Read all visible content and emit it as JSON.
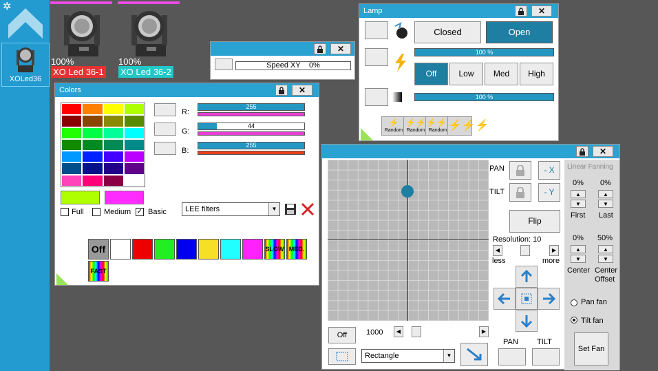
{
  "sidebar": {
    "fixture_label": "XOLed36"
  },
  "fixtures": [
    {
      "pct": "100%",
      "name": "XO Led 36-1",
      "name_bg": "#e53232"
    },
    {
      "pct": "100%",
      "name": "XO Led 36-2",
      "name_bg": "#22c7c7"
    }
  ],
  "speed_window": {
    "label": "Speed XY",
    "value": "0%"
  },
  "lamp": {
    "title": "Lamp",
    "closed": "Closed",
    "open": "Open",
    "intensity": "100 %",
    "off": "Off",
    "low": "Low",
    "med": "Med",
    "high": "High",
    "strobe_intensity": "100 %",
    "random": [
      "Random",
      "Random",
      "Random"
    ]
  },
  "colors": {
    "title": "Colors",
    "r_label": "R:",
    "g_label": "G:",
    "b_label": "B:",
    "r": "255",
    "g": "44",
    "b": "255",
    "full": "Full",
    "medium": "Medium",
    "basic": "Basic",
    "filter": "LEE filters",
    "off": "Off",
    "slow": "SLOW",
    "med": "MED.",
    "fast": "FAST",
    "palette": [
      "#ff0000",
      "#ff8000",
      "#ffff00",
      "#b0ff00",
      "#8a0000",
      "#8a4500",
      "#8a8a00",
      "#5a8a00",
      "#22ff00",
      "#00ff44",
      "#00ff99",
      "#00ffff",
      "#118a00",
      "#008a22",
      "#008a55",
      "#008a8a",
      "#0099ff",
      "#0022ff",
      "#4400ff",
      "#bb00ff",
      "#004f8a",
      "#00128a",
      "#23008a",
      "#60008a",
      "#ff44bb",
      "#ff0077",
      "#8a0045",
      "#ffffff"
    ]
  },
  "pantilt": {
    "pan": "PAN",
    "tilt": "TILT",
    "minus_x": "- X",
    "minus_y": "- Y",
    "flip": "Flip",
    "resolution": "Resolution: 10",
    "less": "less",
    "more": "more",
    "off": "Off",
    "speed_value": "1000",
    "shape": "Rectangle",
    "pan_btn": "PAN",
    "tilt_btn": "TILT",
    "fanning_title": "Linear Fanning",
    "first_pct": "0%",
    "last_pct": "0%",
    "first": "First",
    "last": "Last",
    "center_pct": "0%",
    "offset_pct": "50%",
    "center": "Center",
    "center_offset": "Center\nOffset",
    "pan_fan": "Pan fan",
    "tilt_fan": "Tilt fan",
    "set_fan": "Set Fan"
  }
}
